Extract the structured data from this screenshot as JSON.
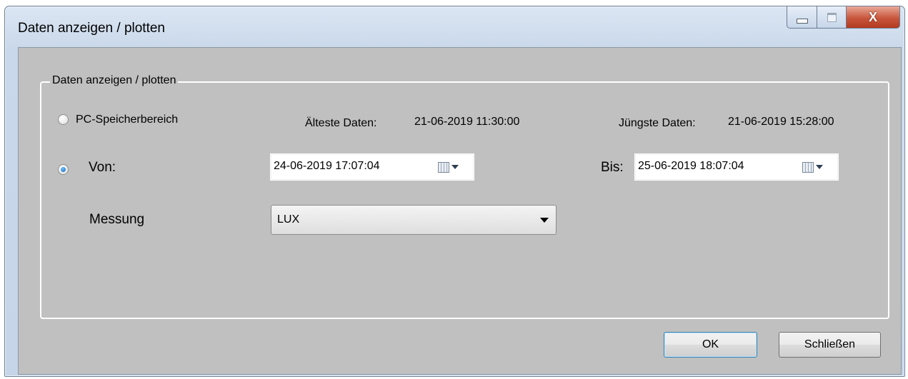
{
  "window": {
    "title": "Daten anzeigen / plotten",
    "close_glyph": "X"
  },
  "group": {
    "legend": "Daten anzeigen / plotten"
  },
  "options": {
    "pc_memory_label": "PC-Speicherbereich",
    "pc_memory_selected": false,
    "from_label": "Von:",
    "from_selected": true
  },
  "info": {
    "oldest_label": "Älteste Daten:",
    "oldest_value": "21-06-2019 11:30:00",
    "newest_label": "Jüngste Daten:",
    "newest_value": "21-06-2019 15:28:00"
  },
  "range": {
    "from_value": "24-06-2019 17:07:04",
    "to_label": "Bis:",
    "to_value": "25-06-2019 18:07:04"
  },
  "measurement": {
    "label": "Messung",
    "selected": "LUX"
  },
  "buttons": {
    "ok": "OK",
    "close": "Schließen"
  },
  "icons": [
    "minimize-icon",
    "maximize-icon",
    "close-icon",
    "calendar-icon",
    "dropdown-arrow-icon"
  ]
}
